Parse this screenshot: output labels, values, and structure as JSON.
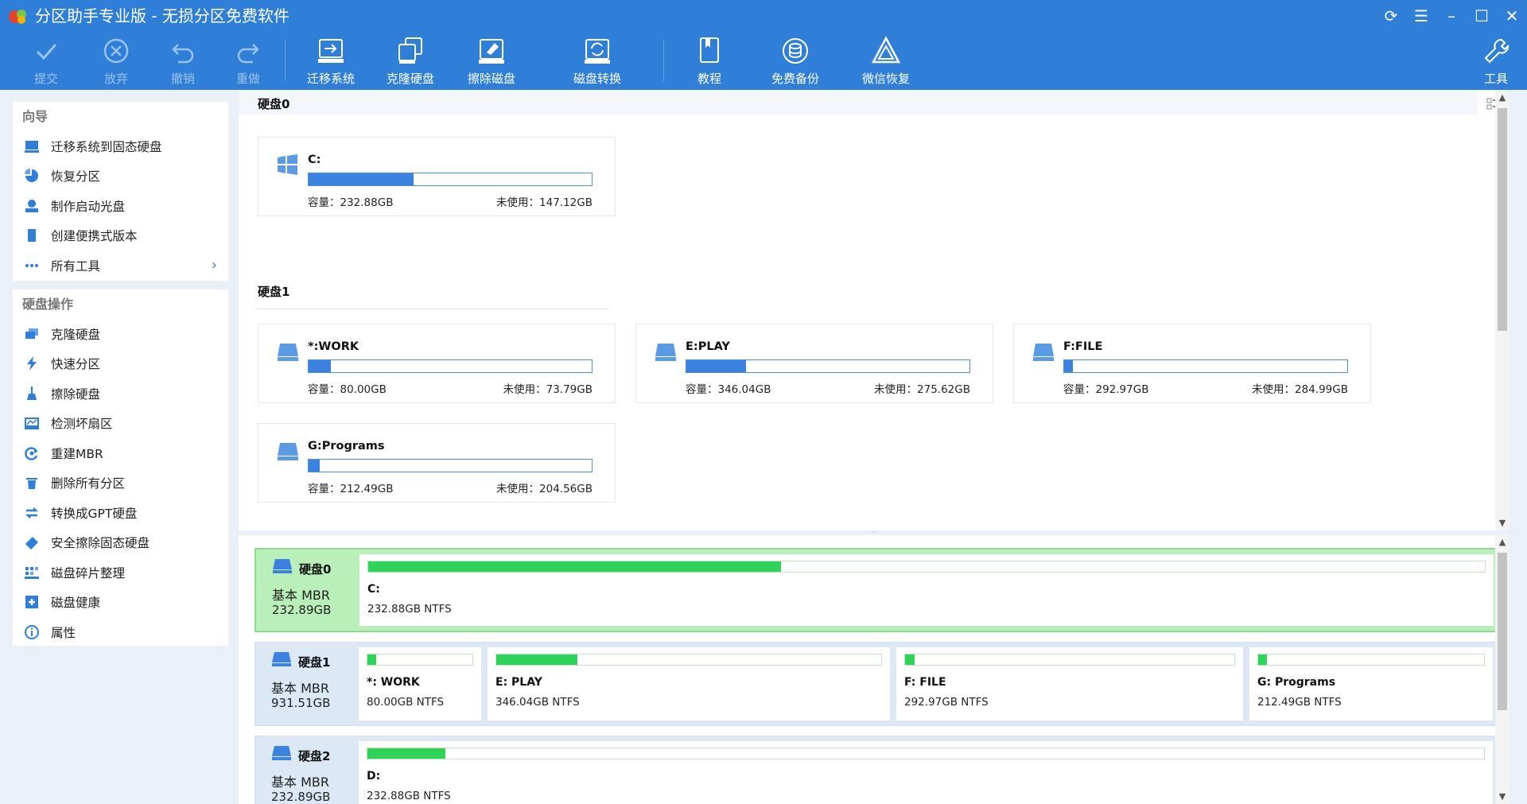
{
  "window": {
    "title": "分区助手专业版 - 无损分区免费软件",
    "controls": [
      "refresh-icon",
      "menu-icon",
      "minimize-icon",
      "maximize-icon",
      "close-icon"
    ]
  },
  "toolbar": {
    "commit": "提交",
    "discard": "放弃",
    "undo": "撤销",
    "redo": "重做",
    "migrate": "迁移系统",
    "clone": "克隆硬盘",
    "wipe": "擦除磁盘",
    "convert": "磁盘转换",
    "tutorial": "教程",
    "backup": "免费备份",
    "wechat": "微信恢复",
    "tools": "工具"
  },
  "sidebar": {
    "wizard_title": "向导",
    "wizard": [
      {
        "label": "迁移系统到固态硬盘"
      },
      {
        "label": "恢复分区"
      },
      {
        "label": "制作启动光盘"
      },
      {
        "label": "创建便携式版本"
      },
      {
        "label": "所有工具"
      }
    ],
    "ops_title": "硬盘操作",
    "ops": [
      {
        "label": "克隆硬盘"
      },
      {
        "label": "快速分区"
      },
      {
        "label": "擦除硬盘"
      },
      {
        "label": "检测坏扇区"
      },
      {
        "label": "重建MBR"
      },
      {
        "label": "删除所有分区"
      },
      {
        "label": "转换成GPT硬盘"
      },
      {
        "label": "安全擦除固态硬盘"
      },
      {
        "label": "磁盘碎片整理"
      },
      {
        "label": "磁盘健康"
      },
      {
        "label": "属性"
      }
    ]
  },
  "upper": {
    "disk0_title": "硬盘0",
    "disk1_title": "硬盘1",
    "cards": [
      {
        "name": "C:",
        "capacity": "容量：232.88GB",
        "free": "未使用：147.12GB",
        "used_fraction": 0.37
      },
      {
        "name": "*:WORK",
        "capacity": "容量：80.00GB",
        "free": "未使用：73.79GB",
        "used_fraction": 0.08
      },
      {
        "name": "E:PLAY",
        "capacity": "容量：346.04GB",
        "free": "未使用：275.62GB",
        "used_fraction": 0.21
      },
      {
        "name": "F:FILE",
        "capacity": "容量：292.97GB",
        "free": "未使用：284.99GB",
        "used_fraction": 0.03
      },
      {
        "name": "G:Programs",
        "capacity": "容量：212.49GB",
        "free": "未使用：204.56GB",
        "used_fraction": 0.04
      }
    ]
  },
  "lower": {
    "disks": [
      {
        "name": "硬盘0",
        "type": "基本 MBR",
        "size": "232.89GB",
        "partitions": [
          {
            "name": "C:",
            "info": "232.88GB NTFS",
            "used_fraction": 0.37
          }
        ]
      },
      {
        "name": "硬盘1",
        "type": "基本 MBR",
        "size": "931.51GB",
        "partitions": [
          {
            "name": "*: WORK",
            "info": "80.00GB NTFS",
            "used_fraction": 0.08
          },
          {
            "name": "E: PLAY",
            "info": "346.04GB NTFS",
            "used_fraction": 0.21
          },
          {
            "name": "F: FILE",
            "info": "292.97GB NTFS",
            "used_fraction": 0.03
          },
          {
            "name": "G: Programs",
            "info": "212.49GB NTFS",
            "used_fraction": 0.04
          }
        ]
      },
      {
        "name": "硬盘2",
        "type": "基本 MBR",
        "size": "232.89GB",
        "partitions": [
          {
            "name": "D:",
            "info": "232.88GB NTFS",
            "used_fraction": 0.07
          }
        ]
      }
    ]
  },
  "colors": {
    "brand": "#2f7fd8",
    "bar_blue": "#3b82e0",
    "bar_green": "#2fd35a",
    "selected_row": "#b9f0b9"
  }
}
